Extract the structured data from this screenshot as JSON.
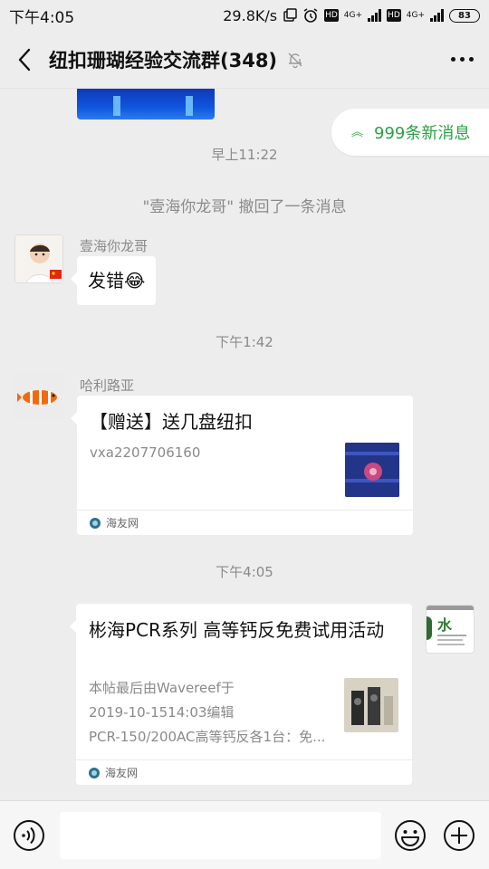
{
  "status_bar": {
    "time": "下午4:05",
    "network_speed": "29.8K/s",
    "hd1": "HD",
    "net1": "4G+",
    "hd2": "HD",
    "net2": "4G+",
    "battery": "83"
  },
  "header": {
    "title": "纽扣珊瑚经验交流群(348)",
    "icons": [
      "back-arrow-icon",
      "mute-bell-icon",
      "more-icon"
    ]
  },
  "chat": {
    "new_messages_label": "999条新消息",
    "timestamps": [
      "早上11:22",
      "下午1:42",
      "下午4:05"
    ],
    "recall_notice": "\"壹海你龙哥\" 撤回了一条消息",
    "messages": [
      {
        "sender": "壹海你龙哥",
        "text": "发错😂"
      },
      {
        "sender": "哈利路亚",
        "card": {
          "title": "【赠送】送几盘纽扣",
          "desc": "vxa2207706160",
          "source": "海友网"
        }
      },
      {
        "sender": "",
        "card": {
          "title": "彬海PCR系列 高等钙反免费试用活动",
          "desc_line1": "本帖最后由Wavereef于",
          "desc_line2": "2019-10-1514:03编辑",
          "desc_line3": "PCR-150/200AC高等钙反各1台：免...",
          "source": "海友网"
        },
        "avatar_text": "水"
      }
    ]
  },
  "input_bar": {
    "placeholder": "",
    "icons": [
      "voice-icon",
      "emoji-icon",
      "plus-icon"
    ]
  },
  "colors": {
    "accent_green": "#2ba245",
    "background": "#ededed"
  }
}
